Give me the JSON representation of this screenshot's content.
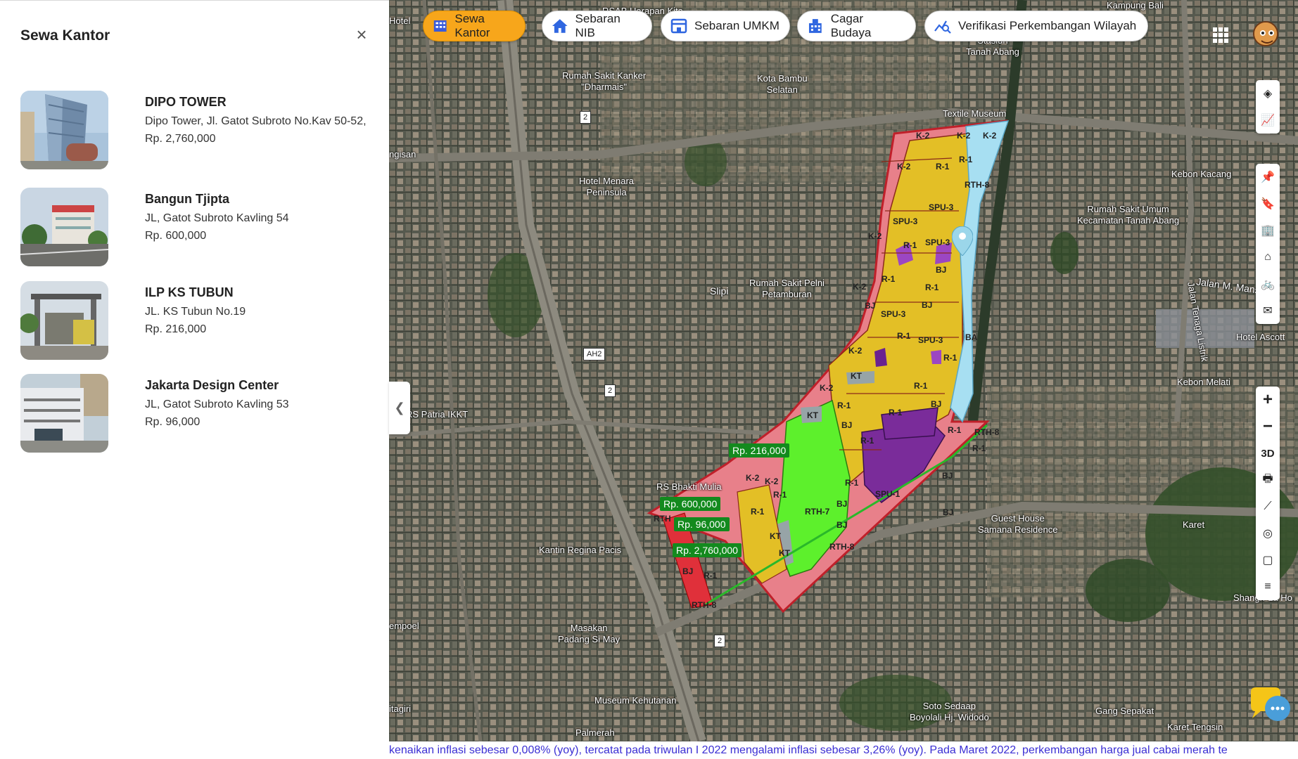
{
  "sidebar": {
    "title": "Sewa Kantor",
    "close_icon": "×",
    "listings": [
      {
        "name": "DIPO TOWER",
        "address": "Dipo Tower, Jl. Gatot Subroto No.Kav 50-52,",
        "price": "Rp. 2,760,000"
      },
      {
        "name": "Bangun Tjipta",
        "address": "JL, Gatot Subroto Kavling 54",
        "price": "Rp. 600,000"
      },
      {
        "name": "ILP KS TUBUN",
        "address": "JL. KS Tubun No.19",
        "price": "Rp. 216,000"
      },
      {
        "name": "Jakarta Design Center",
        "address": "JL, Gatot Subroto Kavling 53",
        "price": "Rp. 96,000"
      }
    ]
  },
  "topnav": {
    "pills": [
      {
        "label": "Sewa Kantor",
        "icon": "building-icon",
        "active": true
      },
      {
        "label": "Sebaran NIB",
        "icon": "home-icon",
        "active": false
      },
      {
        "label": "Sebaran UMKM",
        "icon": "store-icon",
        "active": false
      },
      {
        "label": "Cagar Budaya",
        "icon": "heritage-building-icon",
        "active": false
      },
      {
        "label": "Verifikasi Perkembangan Wilayah",
        "icon": "analytics-search-icon",
        "active": false
      }
    ]
  },
  "map": {
    "place_labels": [
      {
        "text": "RSAB Harapan Kita",
        "name": "label-rsab"
      },
      {
        "text": "Hotel",
        "name": "label-hotel"
      },
      {
        "text": "Rumah Sakit Kanker\n\"Dharmais\"",
        "name": "label-dharmais"
      },
      {
        "text": "Kota Bambu\nSelatan",
        "name": "label-kota-bambu"
      },
      {
        "text": "Stasiun\nTanah Abang",
        "name": "label-stasiun"
      },
      {
        "text": "Textile Museum",
        "name": "label-textile"
      },
      {
        "text": "Kampung Bali",
        "name": "label-kampung-bali"
      },
      {
        "text": "ngisan",
        "name": "label-ngisan"
      },
      {
        "text": "Hotel Menara\nPeninsula",
        "name": "label-menara"
      },
      {
        "text": "Kebon Kacang",
        "name": "label-kebon-kacang"
      },
      {
        "text": "Rumah Sakit Umum\nKecamatan Tanah Abang",
        "name": "label-rsu"
      },
      {
        "text": "Slipi",
        "name": "label-slipi"
      },
      {
        "text": "Rumah Sakit Pelni\nPetamburan",
        "name": "label-pelni"
      },
      {
        "text": "Jalan Tenaga Listrik",
        "name": "label-jalan-tenaga"
      },
      {
        "text": "Jalan M. Mansyur",
        "name": "label-jalan-mansyur"
      },
      {
        "text": "Hotel Ascott",
        "name": "label-ascott"
      },
      {
        "text": "Kebon Melati",
        "name": "label-kebon-melati"
      },
      {
        "text": "RS Patria IKKT",
        "name": "label-patria"
      },
      {
        "text": "RS Bhakti Mulia",
        "name": "label-bhakti"
      },
      {
        "text": "Guest House\nSamana Residence",
        "name": "label-samana"
      },
      {
        "text": "Karet",
        "name": "label-karet"
      },
      {
        "text": "Shangri-La Ho",
        "name": "label-shangrila"
      },
      {
        "text": "Kantin Regina Pacis",
        "name": "label-kantin"
      },
      {
        "text": "empoel",
        "name": "label-empoel"
      },
      {
        "text": "Masakan\nPadang Si May",
        "name": "label-masakan"
      },
      {
        "text": "Museum Kehutanan",
        "name": "label-museum"
      },
      {
        "text": "Soto Sedaap\nBoyolali Hj. Widodo",
        "name": "label-soto"
      },
      {
        "text": "Gang Sepakat",
        "name": "label-gang"
      },
      {
        "text": "Karet Tengsin",
        "name": "label-karet-tengsin"
      },
      {
        "text": "itagiri",
        "name": "label-itagiri"
      },
      {
        "text": "Palmerah",
        "name": "label-palmerah"
      }
    ],
    "road_shields": [
      "2",
      "2",
      "AH2",
      "2",
      "2"
    ],
    "zones": [
      "K-2",
      "K-2",
      "K-2",
      "R-1",
      "K-2",
      "R-1",
      "RTH-8",
      "SPU-3",
      "SPU-3",
      "K-2",
      "R-1",
      "SPU-3",
      "BJ",
      "K-2",
      "R-1",
      "R-1",
      "BJ",
      "SPU-3",
      "BJ",
      "R-1",
      "SPU-3",
      "K-2",
      "R-1",
      "BA",
      "KT",
      "K-2",
      "R-1",
      "KT",
      "R-1",
      "R-1",
      "BJ",
      "BJ",
      "R-1",
      "RTH-8",
      "R-1",
      "R-1",
      "BJ",
      "K-2",
      "K-2",
      "R-1",
      "SPU-1",
      "BJ",
      "R-1",
      "RTH-7",
      "R-1",
      "BJ",
      "BJ",
      "KT",
      "KT",
      "RTH-8",
      "RTH",
      "R-1",
      "BJ",
      "RTH-8",
      "BA"
    ],
    "price_tags": [
      "Rp. 216,000",
      "Rp. 600,000",
      "Rp. 96,000",
      "Rp. 2,760,000"
    ]
  },
  "tools": {
    "group1": [
      "layers-icon",
      "chart-line-icon"
    ],
    "group2": [
      "pin-icon",
      "bookmark-icon",
      "buildings-icon",
      "home-outline-icon",
      "bike-icon",
      "mail-icon"
    ],
    "group3": {
      "zoom_in": "+",
      "zoom_out": "−",
      "three_d": "3D",
      "icons": [
        "print-icon",
        "measure-icon",
        "locate-icon",
        "draw-polygon-icon",
        "stack-icon"
      ]
    }
  },
  "ticker": "kenaikan inflasi sebesar 0,008% (yoy), tercatat pada triwulan I 2022 mengalami inflasi sebesar 3,26% (yoy). Pada Maret 2022, perkembangan harga jual cabai merah te",
  "colors": {
    "accent": "#f7a61b",
    "price_tag": "#138a1e",
    "ticker_text": "#3a2fd4"
  }
}
